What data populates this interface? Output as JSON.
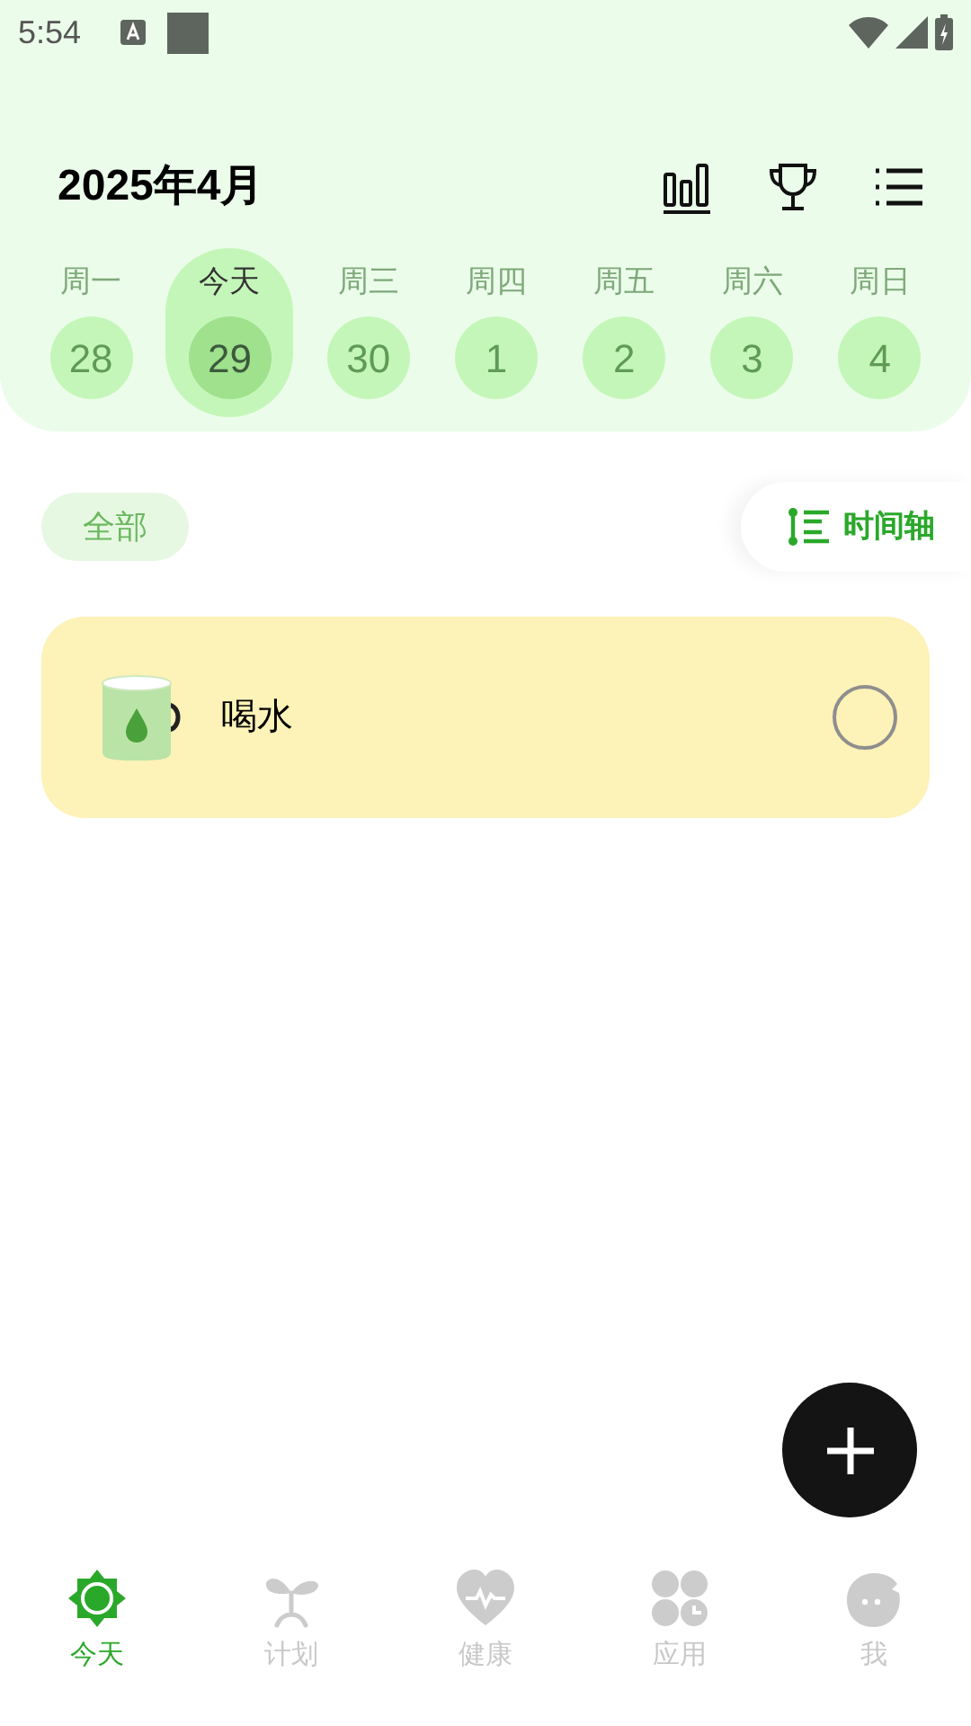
{
  "status_bar": {
    "time": "5:54"
  },
  "header": {
    "title": "2025年4月"
  },
  "week": [
    {
      "label": "周一",
      "day": "28",
      "selected": false
    },
    {
      "label": "今天",
      "day": "29",
      "selected": true
    },
    {
      "label": "周三",
      "day": "30",
      "selected": false
    },
    {
      "label": "周四",
      "day": "1",
      "selected": false
    },
    {
      "label": "周五",
      "day": "2",
      "selected": false
    },
    {
      "label": "周六",
      "day": "3",
      "selected": false
    },
    {
      "label": "周日",
      "day": "4",
      "selected": false
    }
  ],
  "filter": {
    "label": "全部",
    "view_toggle": "时间轴"
  },
  "tasks": [
    {
      "name": "喝水",
      "checked": false
    }
  ],
  "bottom_nav": [
    {
      "label": "今天",
      "selected": true,
      "kind": "today"
    },
    {
      "label": "计划",
      "selected": false,
      "kind": "plan"
    },
    {
      "label": "健康",
      "selected": false,
      "kind": "health"
    },
    {
      "label": "应用",
      "selected": false,
      "kind": "apps"
    },
    {
      "label": "我",
      "selected": false,
      "kind": "me"
    }
  ]
}
